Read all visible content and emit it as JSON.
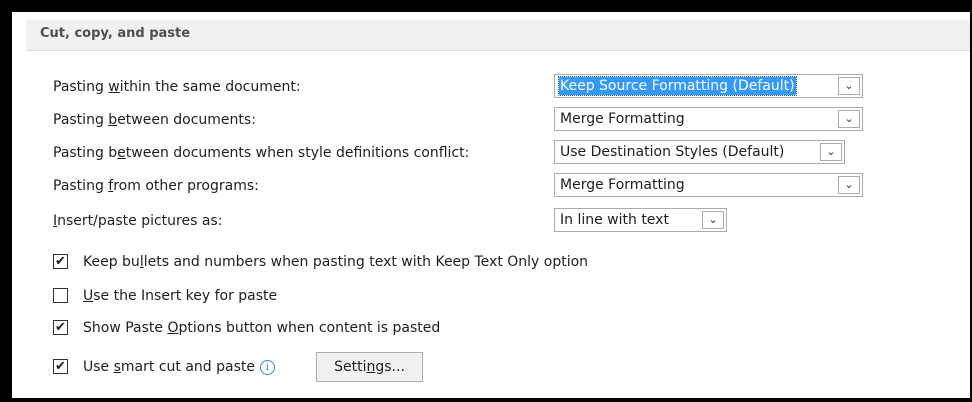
{
  "section": {
    "title": "Cut, copy, and paste"
  },
  "rows": [
    {
      "label_pre": "Pasting ",
      "label_key": "w",
      "label_post": "ithin the same document:",
      "value": "Keep Source Formatting (Default)"
    },
    {
      "label_pre": "Pasting ",
      "label_key": "b",
      "label_post": "etween documents:",
      "value": "Merge Formatting"
    },
    {
      "label_pre": "Pasting b",
      "label_key": "e",
      "label_post": "tween documents when style definitions conflict:",
      "value": "Use Destination Styles (Default)"
    },
    {
      "label_pre": "Pasting ",
      "label_key": "f",
      "label_post": "rom other programs:",
      "value": "Merge Formatting"
    },
    {
      "label_pre": "",
      "label_key": "I",
      "label_post": "nsert/paste pictures as:",
      "value": "In line with text"
    }
  ],
  "checks": [
    {
      "checked": "✔",
      "label_pre": "Keep bu",
      "label_key": "l",
      "label_post": "lets and numbers when pasting text with Keep Text Only option"
    },
    {
      "checked": "",
      "label_pre": "",
      "label_key": "U",
      "label_post": "se the Insert key for paste"
    },
    {
      "checked": "✔",
      "label_pre": "Show Paste ",
      "label_key": "O",
      "label_post": "ptions button when content is pasted"
    },
    {
      "checked": "✔",
      "label_pre": "Use ",
      "label_key": "s",
      "label_post": "mart cut and paste"
    }
  ],
  "info_icon": "i",
  "dropdown_arrow": "⌄",
  "settings_button": {
    "pre": "Setti",
    "key": "n",
    "post": "gs..."
  }
}
